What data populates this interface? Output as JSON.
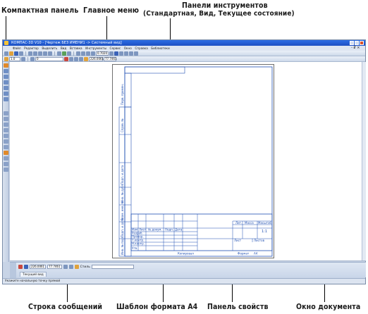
{
  "annotations": {
    "compact_panel": "Компактная панель",
    "main_menu": "Главное меню",
    "toolbars_title": "Панели инструментов",
    "toolbars_subtitle": "(Стандартная, Вид, Текущее состояние)",
    "message_line": "Строка сообщений",
    "template_a4": "Шаблон формата А4",
    "properties_panel": "Панель свойств",
    "document_window": "Окно документа"
  },
  "window": {
    "title": "КОМПАС-3D V10 - [Чертеж БЕЗ ИМЕНИ1 -> Системный вид]"
  },
  "menu": {
    "items": [
      "Файл",
      "Редактор",
      "Выделить",
      "Вид",
      "Вставка",
      "Инструменты",
      "Сервис",
      "Окно",
      "Справка",
      "Библиотеки"
    ],
    "right": "- ₽ ×"
  },
  "toolbar": {
    "zoom_value": "0.7020",
    "scale_value": "1.0",
    "layer_value": "0",
    "coord_x": "226.0061",
    "coord_y": "77.7461"
  },
  "drawing": {
    "title_block": {
      "izm": "Изм",
      "list": "Лист",
      "n_dokum": "№ докум.",
      "podp": "Подп.",
      "data": "Дата",
      "razrab": "Разраб.",
      "prov": "Провер.",
      "t_kontr": "Т.контр.",
      "n_kontr": "Н.контр.",
      "utv": "Утв.",
      "lit": "Лит.",
      "massa": "Масса",
      "masshtab": "Масштаб",
      "masshtab_value": "1:1",
      "list_label": "Лист",
      "listov": "Листов",
      "copied": "Копировал",
      "format": "Формат",
      "format_value": "A4"
    },
    "side_labels": [
      "Перв. примен.",
      "Справ. №",
      "Подп. и дата",
      "Инв. № дубл.",
      "Взам. инв. №",
      "Подп. и дата",
      "Инв. № подл."
    ]
  },
  "properties": {
    "x_value": "226.0061",
    "y_value": "77.7461",
    "style_label": "Стиль",
    "tab_label": "Текущий вид"
  },
  "status": {
    "message": "Укажите начальную точку прямой"
  }
}
